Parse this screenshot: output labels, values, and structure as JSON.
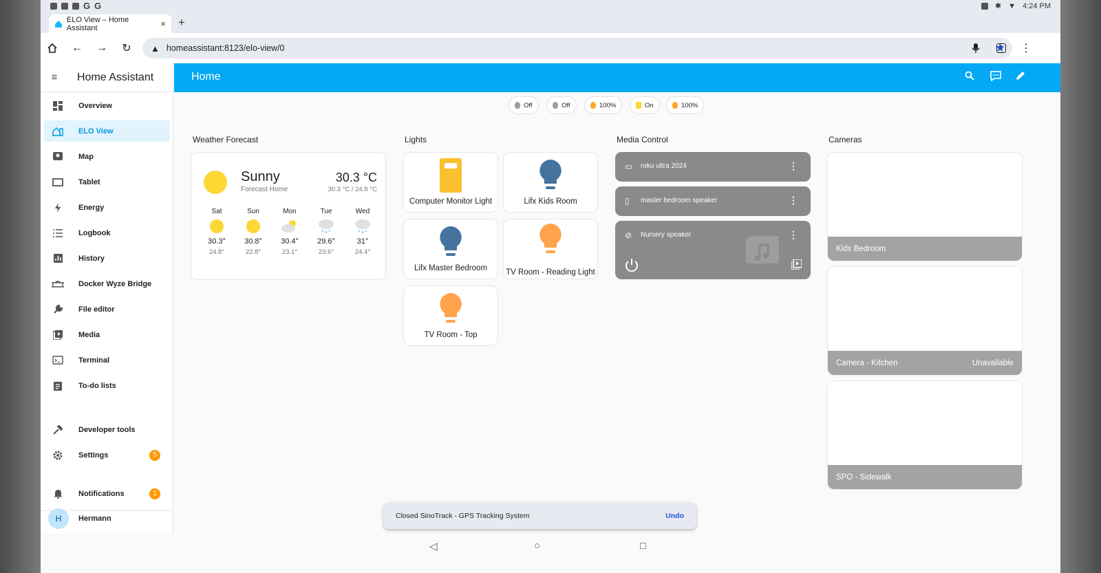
{
  "status_bar": {
    "time": "4:24 PM",
    "left_icons": [
      "notification-icon",
      "mail-icon",
      "cast-icon"
    ],
    "left_g1": "G",
    "left_g2": "G",
    "right_icons": [
      "nfc-icon",
      "bluetooth-icon",
      "wifi-icon"
    ]
  },
  "browser": {
    "tab_title": "ELO View – Home Assistant",
    "tab_close": "×",
    "new_tab": "+",
    "url": "homeassistant:8123/elo-view/0",
    "tab_count": "1"
  },
  "sidebar": {
    "title": "Home Assistant",
    "items": [
      {
        "label": "Overview",
        "icon": "dashboard-icon"
      },
      {
        "label": "ELO View",
        "icon": "home-dashboard-icon",
        "active": true
      },
      {
        "label": "Map",
        "icon": "map-icon"
      },
      {
        "label": "Tablet",
        "icon": "tablet-icon"
      },
      {
        "label": "Energy",
        "icon": "lightning-icon"
      },
      {
        "label": "Logbook",
        "icon": "list-icon"
      },
      {
        "label": "History",
        "icon": "chart-icon"
      },
      {
        "label": "Docker Wyze Bridge",
        "icon": "bridge-icon"
      },
      {
        "label": "File editor",
        "icon": "wrench-icon"
      },
      {
        "label": "Media",
        "icon": "media-icon"
      },
      {
        "label": "Terminal",
        "icon": "terminal-icon"
      },
      {
        "label": "To-do lists",
        "icon": "clipboard-icon"
      }
    ],
    "developer_tools": "Developer tools",
    "settings": "Settings",
    "settings_badge": "5",
    "notifications": "Notifications",
    "notifications_badge": "1",
    "user": "Hermann",
    "user_initial": "H"
  },
  "header": {
    "title": "Home"
  },
  "chips": [
    {
      "label": "Off",
      "color": "#9e9e9e"
    },
    {
      "label": "Off",
      "color": "#9e9e9e"
    },
    {
      "label": "100%",
      "color": "#ffa726"
    },
    {
      "label": "On",
      "color": "#fdd835"
    },
    {
      "label": "100%",
      "color": "#ffa726"
    }
  ],
  "sections": {
    "weather": "Weather Forecast",
    "lights": "Lights",
    "media": "Media Control",
    "cameras": "Cameras"
  },
  "weather": {
    "condition": "Sunny",
    "location": "Forecast Home",
    "temperature": "30.3 °C",
    "high_low": "30.3 °C / 24.8 °C",
    "forecast": [
      {
        "day": "Sat",
        "high": "30.3°",
        "low": "24.8°",
        "icon": "sunny-icon"
      },
      {
        "day": "Sun",
        "high": "30.8°",
        "low": "22.8°",
        "icon": "sunny-icon"
      },
      {
        "day": "Mon",
        "high": "30.4°",
        "low": "23.1°",
        "icon": "partly-cloudy-icon"
      },
      {
        "day": "Tue",
        "high": "29.6°",
        "low": "23.6°",
        "icon": "rainy-icon"
      },
      {
        "day": "Wed",
        "high": "31°",
        "low": "24.4°",
        "icon": "rainy-icon"
      }
    ]
  },
  "lights": [
    {
      "name": "Computer Monitor Light",
      "color": "#fbc02d",
      "icon": "lamp-icon"
    },
    {
      "name": "Lifx Kids Room",
      "color": "#44739e",
      "icon": "bulb-icon"
    },
    {
      "name": "Lifx Master Bedroom",
      "color": "#44739e",
      "icon": "bulb-icon"
    },
    {
      "name": "TV Room - Reading Light",
      "color": "#ffa34d",
      "icon": "bulb-icon"
    },
    {
      "name": "TV Room - Top",
      "color": "#ffa34d",
      "icon": "bulb-icon"
    }
  ],
  "media": [
    {
      "name": "roku ultra 2024",
      "icon": "roku-icon"
    },
    {
      "name": "master bedroom speaker",
      "icon": "speaker-icon"
    },
    {
      "name": "Nursery speaker",
      "icon": "speaker-off-icon"
    }
  ],
  "cameras": [
    {
      "name": "Kids Bedroom",
      "status": ""
    },
    {
      "name": "Camera - Kitchen",
      "status": "Unavailable"
    },
    {
      "name": "SPO - Sidewalk",
      "status": ""
    }
  ],
  "toast": {
    "message": "Closed SinoTrack - GPS Tracking System",
    "action": "Undo"
  }
}
